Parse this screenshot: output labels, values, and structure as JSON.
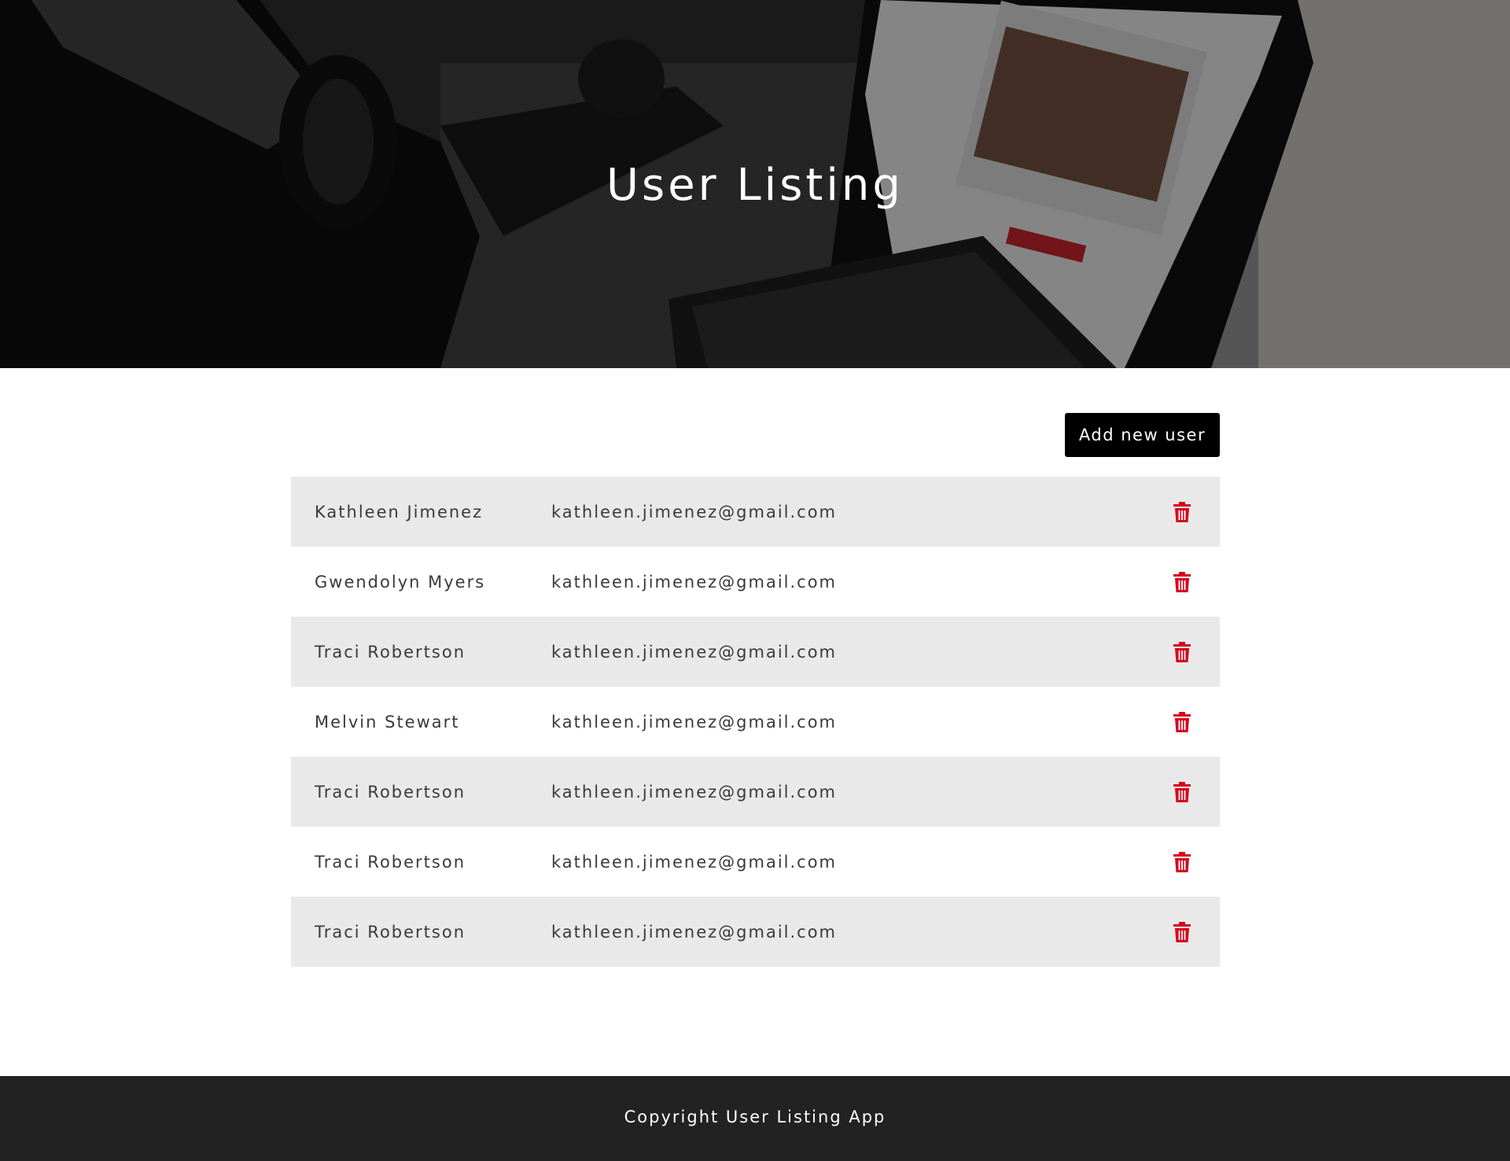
{
  "hero": {
    "title": "User Listing"
  },
  "toolbar": {
    "add_label": "Add new user"
  },
  "users": [
    {
      "name": "Kathleen Jimenez",
      "email": "kathleen.jimenez@gmail.com"
    },
    {
      "name": "Gwendolyn Myers",
      "email": "kathleen.jimenez@gmail.com"
    },
    {
      "name": "Traci Robertson",
      "email": "kathleen.jimenez@gmail.com"
    },
    {
      "name": "Melvin Stewart",
      "email": "kathleen.jimenez@gmail.com"
    },
    {
      "name": "Traci Robertson",
      "email": "kathleen.jimenez@gmail.com"
    },
    {
      "name": "Traci Robertson",
      "email": "kathleen.jimenez@gmail.com"
    },
    {
      "name": "Traci Robertson",
      "email": "kathleen.jimenez@gmail.com"
    }
  ],
  "footer": {
    "copyright": "Copyright User Listing App"
  },
  "icons": {
    "delete": "trash-icon"
  },
  "colors": {
    "accent_delete": "#d9001b",
    "button_bg": "#000000",
    "row_shade": "#e9e9e9",
    "footer_bg": "#222222"
  }
}
